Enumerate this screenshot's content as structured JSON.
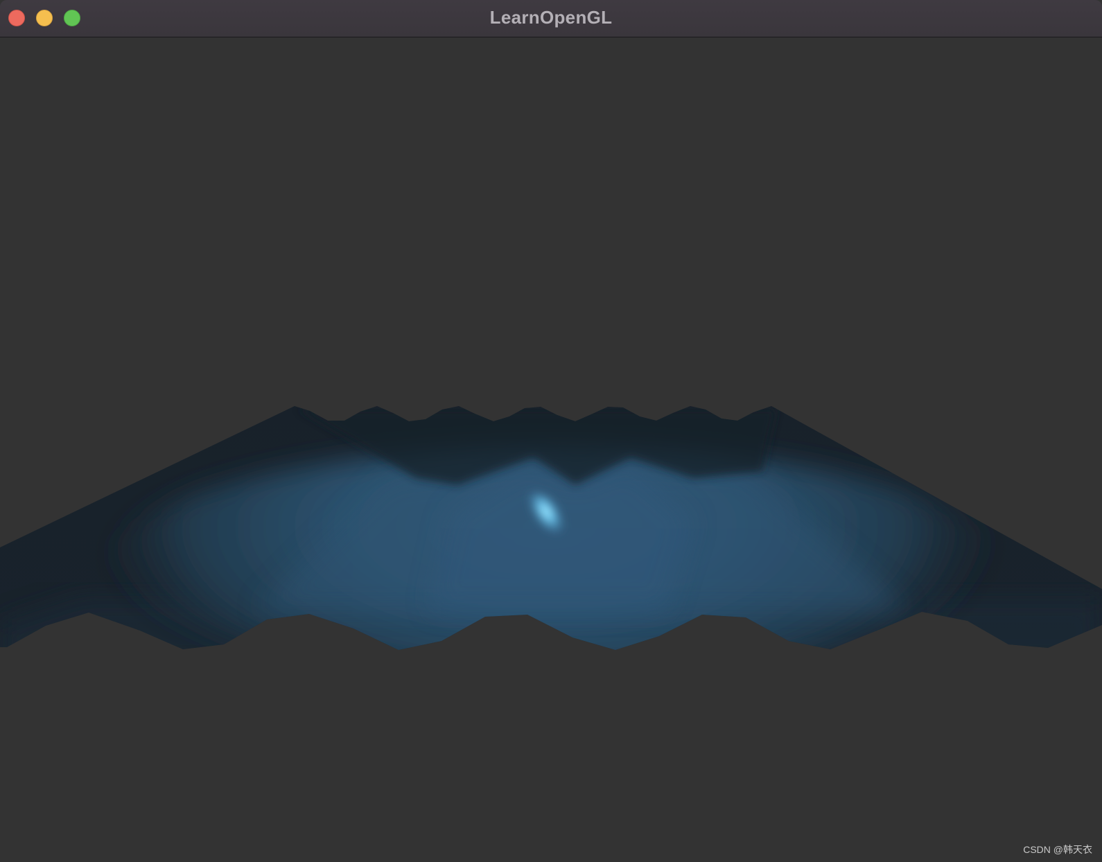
{
  "window": {
    "title": "LearnOpenGL",
    "controls": [
      "close",
      "minimize",
      "zoom"
    ],
    "colors": {
      "titlebar": "#3d393f",
      "background": "#333333",
      "close": "#ed6a5e",
      "minimize": "#f5bf4f",
      "zoom": "#61c554"
    }
  },
  "scene": {
    "description_icon": "terrain-mesh",
    "surface_color": "#2c4f6c",
    "shadow_color": "#172128",
    "highlight_color": "#7fd6f5"
  },
  "watermark": "CSDN @韩天衣"
}
